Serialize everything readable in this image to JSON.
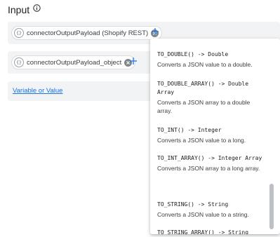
{
  "header": {
    "title": "Input",
    "info_icon": "info-icon"
  },
  "inputs": [
    {
      "chip_icon_text": "{}",
      "chip_label": "connectorOutputPayload (Shopify REST)"
    },
    {
      "chip_icon_text": "{}",
      "chip_label": "connectorOutputPayload_object"
    }
  ],
  "variable_link": "Variable or Value",
  "functions": [
    {
      "signature": "TO_DOUBLE() -> Double",
      "description": "Converts a JSON value to a double."
    },
    {
      "signature": "TO_DOUBLE_ARRAY() -> Double Array",
      "description": "Converts a JSON array to a double array."
    },
    {
      "signature": "TO_INT() -> Integer",
      "description": "Converts a JSON value to a long."
    },
    {
      "signature": "TO_INT_ARRAY() -> Integer Array",
      "description": "Converts a JSON array to a long array."
    },
    {
      "signature": "TO_STRING() -> String",
      "description": "Converts a JSON value to a string."
    },
    {
      "signature": "TO_STRING_ARRAY() -> String",
      "description": ""
    }
  ],
  "colors": {
    "link": "#1a73e8",
    "row_bg": "#f1f3f4",
    "icon": "#5f6368"
  }
}
